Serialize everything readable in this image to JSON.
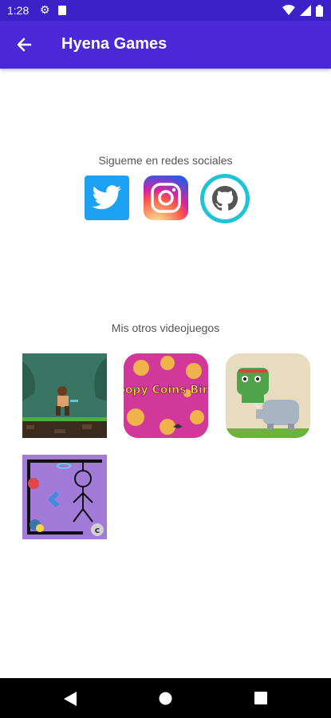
{
  "status_bar": {
    "time": "1:28"
  },
  "app_bar": {
    "title": "Hyena Games"
  },
  "social": {
    "heading": "Sigueme en redes sociales",
    "links": [
      {
        "name": "twitter-icon"
      },
      {
        "name": "instagram-icon"
      },
      {
        "name": "github-icon"
      }
    ]
  },
  "games": {
    "heading": "Mis otros videojuegos",
    "items": [
      {
        "title": "jungle runner"
      },
      {
        "title": "Poopy Coins Birds",
        "art_text": "Poopy Coins Birds"
      },
      {
        "title": "frog rhino"
      },
      {
        "title": "hangman",
        "art_text": "c"
      }
    ]
  },
  "colors": {
    "status_bar": "#3c20c8",
    "app_bar": "#4a28d8",
    "twitter": "#1da1f2",
    "github_ring": "#1ec4d6"
  }
}
